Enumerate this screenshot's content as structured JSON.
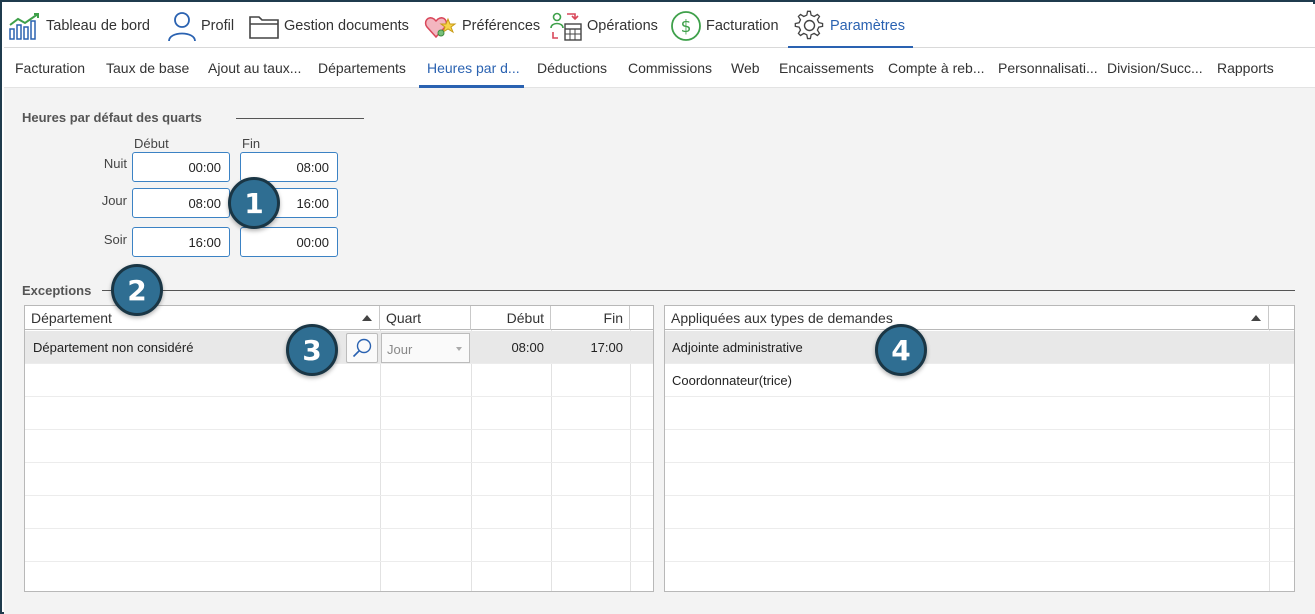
{
  "topnav": {
    "items": [
      {
        "label": "Tableau de bord",
        "icon": "dashboard-chart-icon"
      },
      {
        "label": "Profil",
        "icon": "user-icon"
      },
      {
        "label": "Gestion documents",
        "icon": "folder-icon"
      },
      {
        "label": "Préférences",
        "icon": "hearts-icon"
      },
      {
        "label": "Opérations",
        "icon": "operations-icon"
      },
      {
        "label": "Facturation",
        "icon": "dollar-icon"
      },
      {
        "label": "Paramètres",
        "icon": "gear-icon"
      }
    ],
    "active": "Paramètres"
  },
  "subtabs": {
    "items": [
      "Facturation",
      "Taux de base",
      "Ajout au taux...",
      "Départements",
      "Heures par d...",
      "Déductions",
      "Commissions",
      "Web",
      "Encaissements",
      "Compte à reb...",
      "Personnalisati...",
      "Division/Succ...",
      "Rapports"
    ],
    "active": "Heures par d..."
  },
  "shifts": {
    "title": "Heures par défaut des quarts",
    "col_start": "Début",
    "col_end": "Fin",
    "rows": [
      {
        "label": "Nuit",
        "start": "00:00",
        "end": "08:00"
      },
      {
        "label": "Jour",
        "start": "08:00",
        "end": "16:00"
      },
      {
        "label": "Soir",
        "start": "16:00",
        "end": "00:00"
      }
    ]
  },
  "exceptions": {
    "title": "Exceptions",
    "columns": {
      "department": "Département",
      "shift": "Quart",
      "start": "Début",
      "end": "Fin"
    },
    "rows": [
      {
        "department": "Département non considéré",
        "shift": "Jour",
        "start": "08:00",
        "end": "17:00"
      }
    ]
  },
  "request_types": {
    "header": "Appliquées aux types de demandes",
    "rows": [
      "Adjointe administrative",
      "Coordonnateur(trice)"
    ]
  },
  "badges": [
    "1",
    "2",
    "3",
    "4"
  ],
  "colors": {
    "accent": "#2a62b1",
    "badge": "#2f6e92",
    "field_border": "#3b82c4"
  }
}
